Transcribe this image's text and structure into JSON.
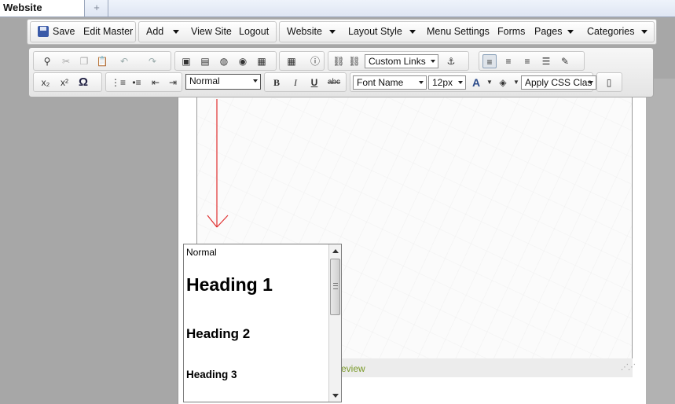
{
  "browser": {
    "tab_title": "Website",
    "new_tab_glyph": "+"
  },
  "menubar": {
    "save": "Save",
    "edit_master": "Edit Master",
    "add": "Add",
    "view_site": "View Site",
    "logout": "Logout",
    "website": "Website",
    "layout_style": "Layout Style",
    "menu_settings": "Menu Settings",
    "forms": "Forms",
    "pages": "Pages",
    "categories": "Categories"
  },
  "toolbar": {
    "custom_links": "Custom Links",
    "format_value": "Normal",
    "font_name": "Font Name",
    "font_size": "12px",
    "apply_css": "Apply CSS Clas",
    "bold": "B",
    "italic": "I",
    "underline": "U",
    "strike": "abc",
    "subscript": "x₂",
    "superscript": "x²",
    "omega": "Ω",
    "font_color": "A",
    "icons": [
      "find-icon",
      "cut-icon",
      "copy-icon",
      "paste-icon",
      "undo-icon",
      "redo-icon",
      "image-icon",
      "document-icon",
      "flash-icon",
      "media-icon",
      "template-icon",
      "table-icon",
      "help-icon",
      "link-icon",
      "unlink-icon",
      "anchor-icon",
      "align-left-icon",
      "align-center-icon",
      "align-right-icon",
      "justify-icon",
      "clean-icon",
      "ordered-list-icon",
      "unordered-list-icon",
      "outdent-icon",
      "indent-icon",
      "highlight-icon",
      "source-icon"
    ]
  },
  "format_dropdown": {
    "options": [
      "Normal",
      "Heading 1",
      "Heading 2",
      "Heading 3"
    ]
  },
  "editor": {
    "preview_label": "review"
  },
  "colors": {
    "annotation_arrow": "#e03030",
    "preview_text": "#7a9a2a",
    "page_background": "#a7a7a7"
  }
}
